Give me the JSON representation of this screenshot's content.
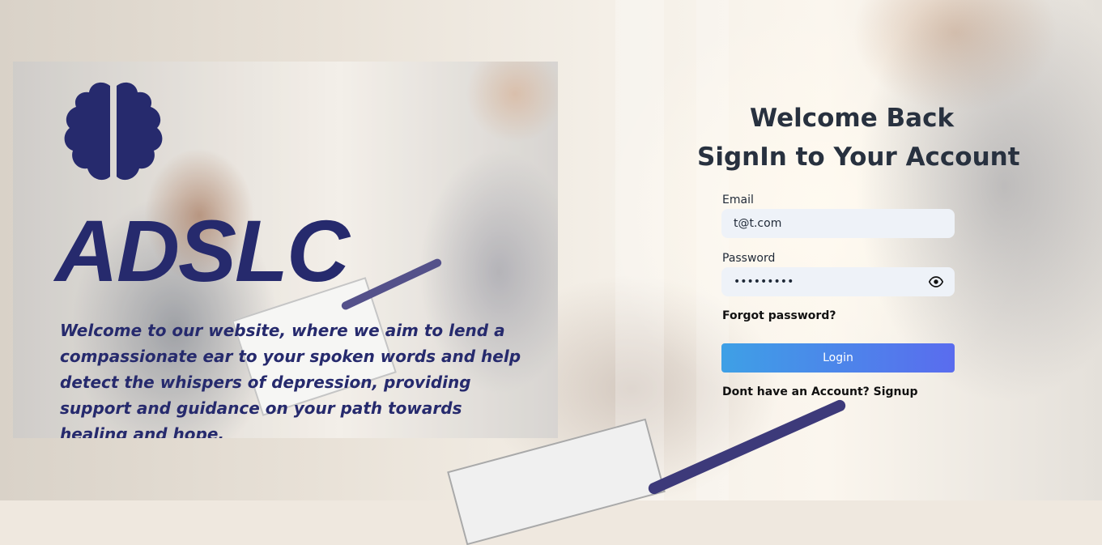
{
  "brand": {
    "name": "ADSLC",
    "tagline": "Welcome to our website, where we aim to lend a compassionate ear to your spoken words and help detect the whispers of depression, providing support and guidance on your path towards healing and hope."
  },
  "form": {
    "heading": "Welcome Back",
    "subheading": "SignIn to Your Account",
    "email_label": "Email",
    "email_value": "t@t.com",
    "password_label": "Password",
    "password_value": "123456789",
    "forgot_label": "Forgot password?",
    "login_label": "Login",
    "signup_prompt": "Dont have an Account?",
    "signup_label": "Signup"
  },
  "icons": {
    "logo": "brain-icon",
    "password_toggle": "eye-icon"
  },
  "colors": {
    "brand": "#262a6d",
    "heading": "#28313f",
    "button_start": "#3ea0e6",
    "button_end": "#5a6cee",
    "input_bg": "#eef2f8"
  }
}
